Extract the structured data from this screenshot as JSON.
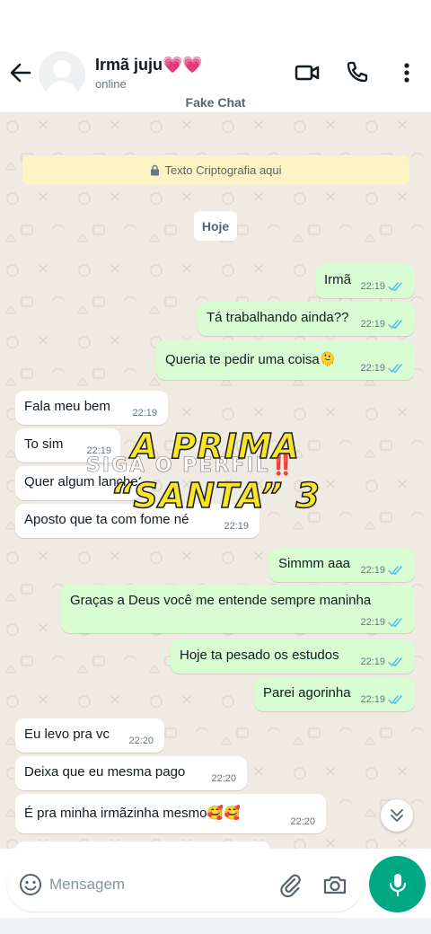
{
  "header": {
    "contact_name": "Irmã juju💗💗",
    "status": "online",
    "app_label": "Fake Chat"
  },
  "chat": {
    "encryption_notice": "Texto Criptografia aqui",
    "day_label": "Hoje",
    "messages": [
      {
        "dir": "out",
        "text": "Irmã",
        "time": "22:19"
      },
      {
        "dir": "out",
        "text": "Tá trabalhando ainda??",
        "time": "22:19"
      },
      {
        "dir": "out",
        "text": "Queria te pedir uma coisa🫠",
        "time": "22:19"
      },
      {
        "dir": "in",
        "text": "Fala meu bem",
        "time": "22:19"
      },
      {
        "dir": "in",
        "text": "To sim",
        "time": "22:19"
      },
      {
        "dir": "in",
        "text": "Quer algum lanche?",
        "time": "22:19"
      },
      {
        "dir": "in",
        "text": "Aposto que ta com fome né",
        "time": "22:19"
      },
      {
        "dir": "out",
        "text": "Simmm aaa",
        "time": "22:19"
      },
      {
        "dir": "out",
        "text": "Graças a Deus você me entende sempre maninha",
        "time": "22:19"
      },
      {
        "dir": "out",
        "text": "Hoje ta pesado os estudos",
        "time": "22:19"
      },
      {
        "dir": "out",
        "text": "Parei agorinha",
        "time": "22:19"
      },
      {
        "dir": "in",
        "text": "Eu levo pra vc",
        "time": "22:20"
      },
      {
        "dir": "in",
        "text": "Deixa que eu mesma pago",
        "time": "22:20"
      },
      {
        "dir": "in",
        "text": "É pra minha irmãzinha mesmo🥰🥰",
        "time": "22:20"
      }
    ]
  },
  "overlay": {
    "title_line1": "A PRIMA",
    "title_line2": "“SANTA” 3",
    "subtitle": "SIGA O PERFIL",
    "subtitle_mark": "‼️"
  },
  "compose": {
    "placeholder": "Mensagem"
  },
  "colors": {
    "accent": "#00a884",
    "outgoing_bubble": "#d9fdd3",
    "incoming_bubble": "#ffffff",
    "chat_background": "#efeae2",
    "read_ticks": "#53bdeb",
    "overlay_title": "#f7e52a"
  },
  "icons": {
    "back": "arrow-left-icon",
    "video": "video-camera-icon",
    "call": "phone-icon",
    "menu": "more-vertical-icon",
    "lock": "lock-icon",
    "ticks": "double-check-icon",
    "scroll": "chevron-double-down-icon",
    "emoji": "emoji-icon",
    "attach": "paperclip-icon",
    "camera": "camera-icon",
    "mic": "microphone-icon"
  }
}
